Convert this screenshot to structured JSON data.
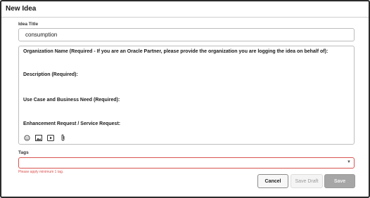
{
  "dialog": {
    "title": "New Idea"
  },
  "idea_title": {
    "label": "Idea Title",
    "value": "consumption"
  },
  "editor": {
    "lines": [
      "Organization Name (Required - If you are an Oracle Partner, please provide the organization you are logging the idea on behalf of):",
      "Description (Required):",
      "Use Case and Business Need (Required):",
      "Enhancement Request / Service Request:"
    ],
    "toolbar_icons": [
      "emoji-icon",
      "image-icon",
      "video-icon",
      "attachment-icon"
    ]
  },
  "tags": {
    "label": "Tags",
    "value": "",
    "error": "Please apply minimum 1 tag."
  },
  "buttons": {
    "cancel": "Cancel",
    "save_draft": "Save Draft",
    "save": "Save"
  },
  "colors": {
    "error": "#d9534f",
    "disabled_save": "#a6a6a6"
  }
}
